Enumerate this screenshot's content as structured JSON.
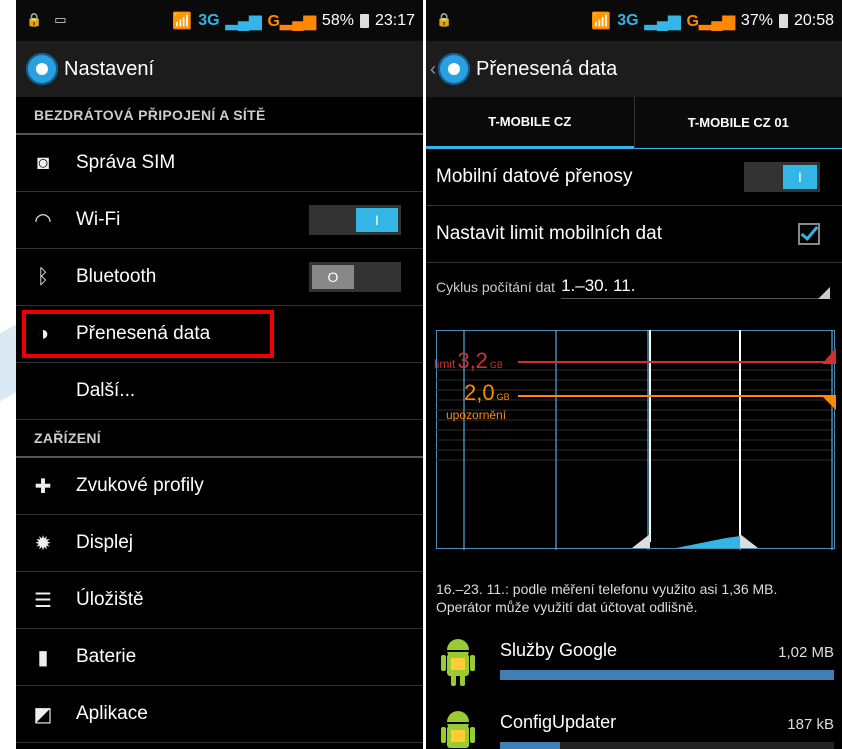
{
  "left_phone": {
    "status": {
      "signal": "3G",
      "battery": "58%",
      "time": "23:17"
    },
    "title": "Nastavení",
    "sections": [
      {
        "header": "BEZDRÁTOVÁ PŘIPOJENÍ A SÍTĚ",
        "items": [
          {
            "label": "Správa SIM",
            "icon": "sim-icon"
          },
          {
            "label": "Wi-Fi",
            "icon": "wifi-icon",
            "toggle": "on",
            "toggle_label": "I"
          },
          {
            "label": "Bluetooth",
            "icon": "bluetooth-icon",
            "toggle": "off",
            "toggle_label": "O"
          },
          {
            "label": "Přenesená data",
            "icon": "data-usage-icon",
            "highlighted": true
          },
          {
            "label": "Další...",
            "icon": ""
          }
        ]
      },
      {
        "header": "ZAŘÍZENÍ",
        "items": [
          {
            "label": "Zvukové profily",
            "icon": "sound-icon"
          },
          {
            "label": "Displej",
            "icon": "display-icon"
          },
          {
            "label": "Úložiště",
            "icon": "storage-icon"
          },
          {
            "label": "Baterie",
            "icon": "battery-icon"
          },
          {
            "label": "Aplikace",
            "icon": "apps-icon"
          }
        ]
      }
    ]
  },
  "right_phone": {
    "status": {
      "signal": "3G",
      "battery": "37%",
      "time": "20:58"
    },
    "title": "Přenesená data",
    "tabs": [
      "T-MOBILE CZ",
      "T-MOBILE CZ 01"
    ],
    "mobile_data_label": "Mobilní datové přenosy",
    "mobile_data_toggle": "I",
    "limit_label": "Nastavit limit mobilních dat",
    "cycle_label": "Cyklus počítání dat",
    "cycle_value": "1.–30. 11.",
    "limit_prefix": "limit",
    "limit_value": "3,2",
    "limit_unit": "GB",
    "warning_value": "2,0",
    "warning_unit": "GB",
    "warning_label": "upozornění",
    "usage_note": "16.–23. 11.: podle měření telefonu využito asi 1,36 MB. Operátor může využití dat účtovat odlišně.",
    "apps": [
      {
        "name": "Služby Google",
        "size": "1,02 MB",
        "fraction": 1.0
      },
      {
        "name": "ConfigUpdater",
        "size": "187 kB",
        "fraction": 0.18
      }
    ]
  },
  "colors": {
    "accent": "#33b5e5",
    "limit": "#d32f2f",
    "warning": "#ff8800",
    "highlight": "#ee0000"
  }
}
